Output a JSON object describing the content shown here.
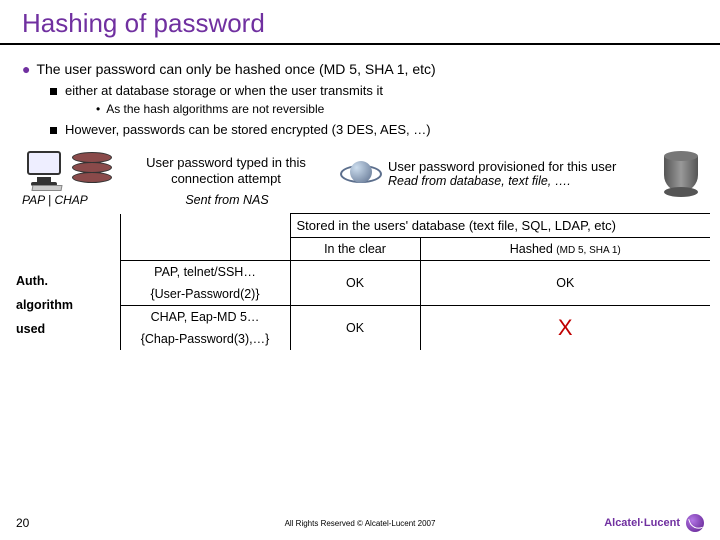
{
  "title": "Hashing of password",
  "bullets": {
    "main": "The user password can only be hashed once (MD 5, SHA 1, etc)",
    "sub1": "either at database storage or when the user transmits it",
    "subsub": "As the hash algorithms are not reversible",
    "sub2": "However, passwords can be stored encrypted (3 DES, AES, …)"
  },
  "diagram": {
    "left_caption": "User password typed in this connection attempt",
    "pap_chap": "PAP | CHAP",
    "sent_from": "Sent from NAS",
    "right_caption": "User password provisioned for this user",
    "read_from": "Read from database, text file, …."
  },
  "table": {
    "stored": "Stored in the users' database (text file, SQL, LDAP, etc)",
    "clear": "In the clear",
    "hashed": "Hashed ",
    "hashed_note": "(MD 5, SHA 1)",
    "algo_label_1": "Auth.",
    "algo_label_2": "algorithm",
    "algo_label_3": "used",
    "row1_proto": "PAP, telnet/SSH…",
    "row1_attr": "{User-Password(2)}",
    "row2_proto": "CHAP, Eap-MD 5…",
    "row2_attr": "{Chap-Password(3),…}",
    "ok": "OK",
    "x": "X"
  },
  "footer": {
    "page": "20",
    "copyright": "All Rights Reserved © Alcatel-Lucent 2007",
    "brand": "Alcatel·Lucent"
  }
}
